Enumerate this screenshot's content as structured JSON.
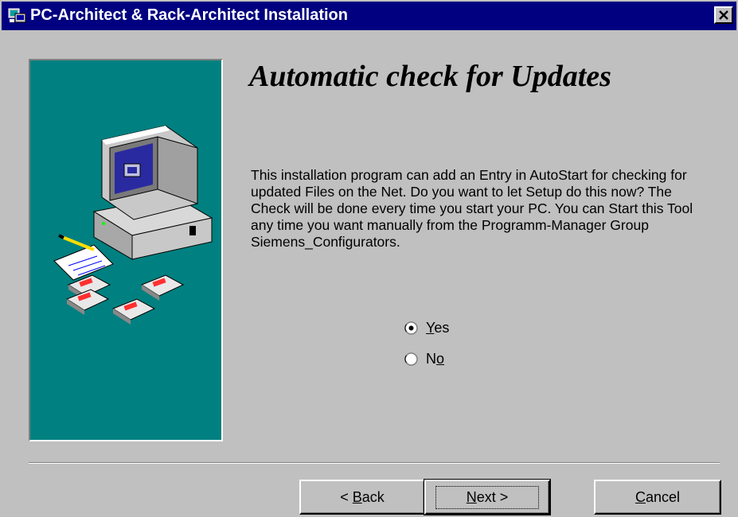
{
  "window": {
    "title": "PC-Architect & Rack-Architect Installation",
    "close_glyph": "✕"
  },
  "page": {
    "heading": "Automatic check for Updates",
    "description": "This installation program can add an Entry in AutoStart for checking for updated Files on the Net. Do you want to let Setup do this now? The Check will be done every time you start your PC. You can Start this Tool any time you want manually from the Programm-Manager Group Siemens_Configurators."
  },
  "options": {
    "yes": {
      "prefix": "",
      "accel": "Y",
      "suffix": "es",
      "selected": true
    },
    "no": {
      "prefix": "N",
      "accel": "o",
      "suffix": "",
      "selected": false
    }
  },
  "buttons": {
    "back": {
      "prefix": "< ",
      "accel": "B",
      "suffix": "ack"
    },
    "next": {
      "prefix": "",
      "accel": "N",
      "suffix": "ext >"
    },
    "cancel": {
      "prefix": "",
      "accel": "C",
      "suffix": "ancel"
    }
  },
  "icons": {
    "title": "setup-computer-icon",
    "art": "computer-with-floppy-disks-illustration"
  },
  "colors": {
    "titlebar": "#000080",
    "art_panel": "#008080",
    "face": "#c0c0c0"
  }
}
